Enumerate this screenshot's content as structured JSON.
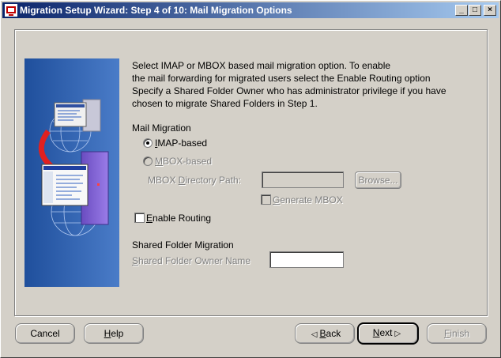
{
  "window": {
    "title": "Migration Setup Wizard:  Step 4 of 10: Mail Migration Options",
    "minimize": "_",
    "maximize": "□",
    "close": "×"
  },
  "description": [
    "Select IMAP or MBOX based mail migration option. To enable",
    "the mail forwarding for migrated users select the Enable Routing option",
    "Specify a Shared Folder Owner who has administrator privilege if you have",
    "chosen to migrate Shared Folders in Step 1."
  ],
  "mail_migration": {
    "heading": "Mail Migration",
    "imap": {
      "label_first": "I",
      "label_rest": "MAP-based",
      "selected": true
    },
    "mbox": {
      "label_first": "M",
      "label_rest": "BOX-based",
      "selected": false
    },
    "dir_path": {
      "label_a": "MBOX ",
      "label_u": "D",
      "label_b": "irectory Path:",
      "value": ""
    },
    "browse": {
      "label": "Browse..."
    },
    "generate": {
      "label_first": "G",
      "label_rest": "enerate MBOX",
      "checked": false
    }
  },
  "routing": {
    "label_first": "E",
    "label_rest": "nable Routing",
    "checked": false
  },
  "shared_folder": {
    "heading": "Shared Folder Migration",
    "owner_label_first": "S",
    "owner_label_rest": "hared Folder Owner Name",
    "owner_value": ""
  },
  "buttons": {
    "cancel": "Cancel",
    "help_first": "H",
    "help_rest": "elp",
    "back_first": "B",
    "back_rest": "ack",
    "next_first": "N",
    "next_rest": "ext",
    "finish_first": "F",
    "finish_rest": "inish"
  }
}
